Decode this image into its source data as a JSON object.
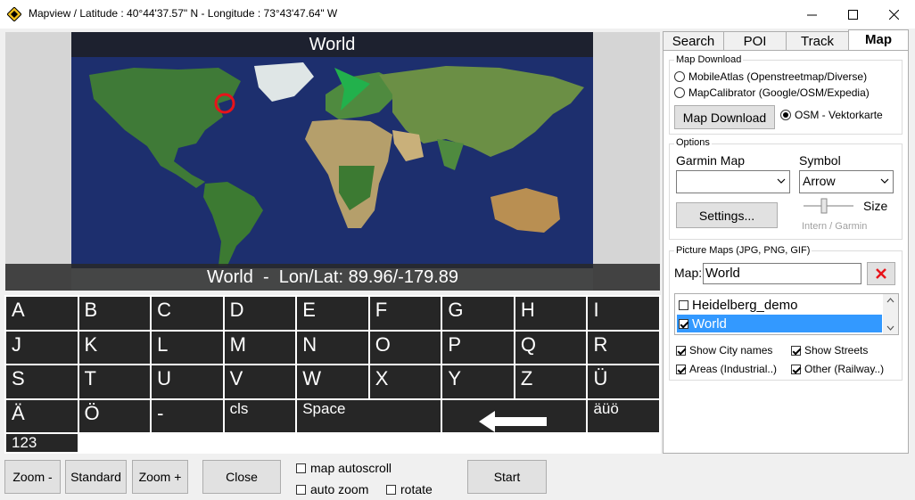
{
  "window": {
    "title": "Mapview / Latitude : 40°44'37.57\" N - Longitude : 73°43'47.64\" W"
  },
  "map": {
    "title": "World",
    "status": "World  -  Lon/Lat: 89.96/-179.89",
    "ocean_color": "#1d2f6e",
    "land_color": "#3f7a37",
    "marker_color": "#e8131a",
    "pointer_color": "#22b14c"
  },
  "keyboard": {
    "row1": [
      "A",
      "B",
      "C",
      "D",
      "E",
      "F",
      "G",
      "H",
      "I"
    ],
    "row2": [
      "J",
      "K",
      "L",
      "M",
      "N",
      "O",
      "P",
      "Q",
      "R"
    ],
    "row3": [
      "S",
      "T",
      "U",
      "V",
      "W",
      "X",
      "Y",
      "Z",
      "Ü"
    ],
    "row4": [
      "Ä",
      "Ö",
      "-",
      "cls",
      "Space",
      "äüö",
      "123"
    ]
  },
  "controls": {
    "zoom_out": "Zoom -",
    "standard": "Standard",
    "zoom_in": "Zoom +",
    "close": "Close",
    "map_autoscroll": "map autoscroll",
    "auto_zoom": "auto zoom",
    "rotate": "rotate",
    "start": "Start"
  },
  "tabs": [
    "Search",
    "POI",
    "Track",
    "Map"
  ],
  "map_download": {
    "group_title": "Map Download",
    "option1": "MobileAtlas (Openstreetmap/Diverse)",
    "option2": "MapCalibrator (Google/OSM/Expedia)",
    "button": "Map Download",
    "option3": "OSM - Vektorkarte"
  },
  "options": {
    "group_title": "Options",
    "garmin_map_label": "Garmin Map",
    "garmin_map_value": "",
    "symbol_label": "Symbol",
    "symbol_value": "Arrow",
    "size_label": "Size",
    "settings_button": "Settings...",
    "slider_caption": "Intern / Garmin"
  },
  "picture_maps": {
    "group_title": "Picture Maps (JPG, PNG, GIF)",
    "map_label": "Map:",
    "map_value": "World",
    "items": [
      {
        "label": "Heidelberg_demo",
        "checked": false
      },
      {
        "label": "World",
        "checked": true
      }
    ],
    "show_city_names": "Show City names",
    "show_streets": "Show Streets",
    "areas": "Areas (Industrial..)",
    "other": "Other (Railway..)"
  }
}
